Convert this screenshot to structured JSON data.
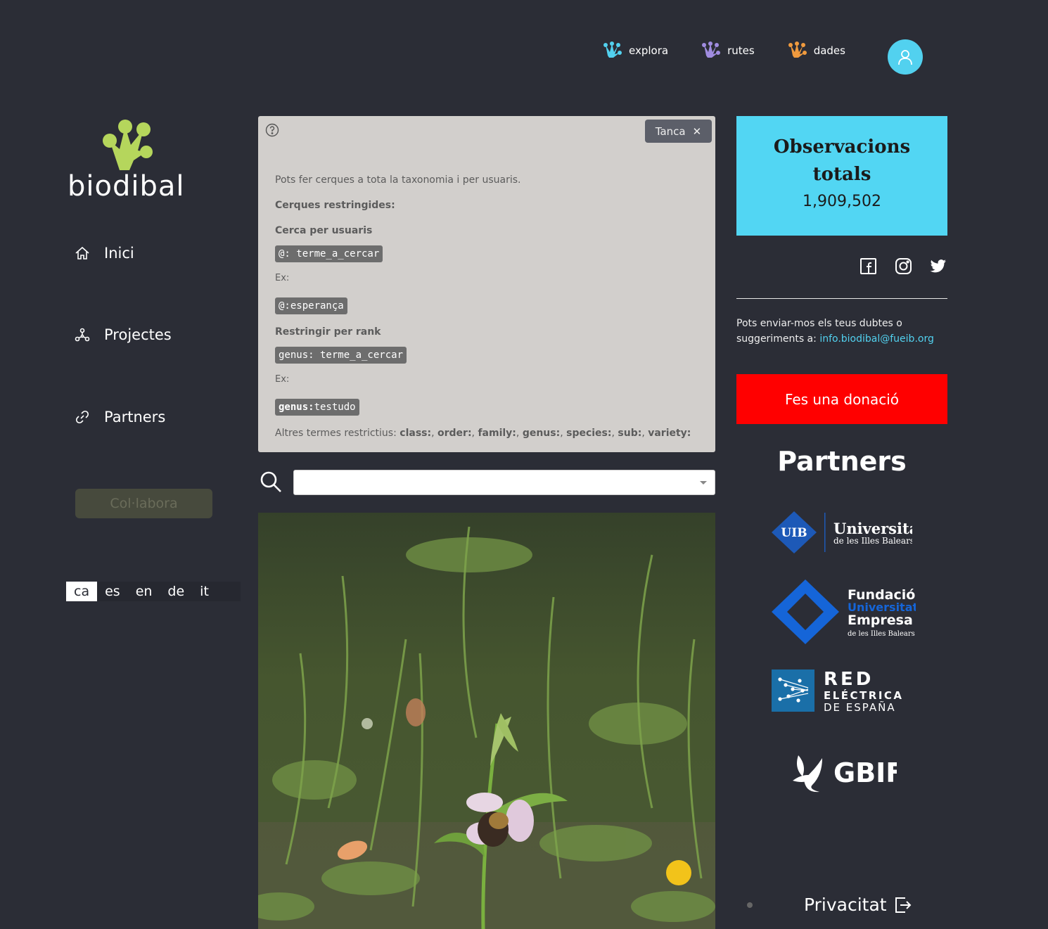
{
  "nav": {
    "items": [
      {
        "label": "explora",
        "color": "#52d1ef"
      },
      {
        "label": "rutes",
        "color": "#a08ce0"
      },
      {
        "label": "dades",
        "color": "#f09a3e"
      }
    ]
  },
  "brand": {
    "name": "biodibal",
    "accent": "#b5d65c"
  },
  "sidebar": {
    "items": [
      {
        "label": "Inici",
        "icon": "home-icon"
      },
      {
        "label": "Projectes",
        "icon": "network-icon"
      },
      {
        "label": "Partners",
        "icon": "link-icon"
      }
    ],
    "collabora": "Col·labora",
    "languages": [
      "ca",
      "es",
      "en",
      "de",
      "it"
    ],
    "active_language": "ca"
  },
  "help": {
    "close_label": "Tanca",
    "intro": "Pots fer cerques a tota la taxonomia i per usuaris.",
    "restricted_heading": "Cerques restringides:",
    "users_heading": "Cerca per usuaris",
    "users_code": "@: terme_a_cercar",
    "ex_label": "Ex:",
    "users_example": "@:esperança",
    "rank_heading": "Restringir per rank",
    "rank_code": "genus: terme_a_cercar",
    "rank_example_key": "genus:",
    "rank_example_value": "testudo",
    "other_label": "Altres termes restrictius:",
    "other_terms": [
      {
        "term": "class:",
        "sep": ", "
      },
      {
        "term": "order:",
        "sep": ", "
      },
      {
        "term": "family:",
        "sep": ", "
      },
      {
        "term": "genus:",
        "sep": ", "
      },
      {
        "term": "species:",
        "sep": ", "
      },
      {
        "term": "sub:",
        "sep": ", "
      },
      {
        "term": "variety:",
        "sep": ""
      }
    ]
  },
  "search": {
    "value": "",
    "placeholder": ""
  },
  "stats": {
    "title_line1": "Observacions",
    "title_line2": "totals",
    "value": "1,909,502"
  },
  "contact": {
    "text": "Pots enviar-mos els teus dubtes o suggeriments a:",
    "email": "info.biodibal@fueib.org"
  },
  "donate_label": "Fes una donació",
  "partners": {
    "title": "Partners",
    "uib": {
      "badge": "UIB",
      "name": "Universitat",
      "sub": "de les Illes Balears"
    },
    "fueib": {
      "line1": "Fundació",
      "line2": "Universitat",
      "line3": "Empresa",
      "sub": "de les Illes Balears"
    },
    "ree": {
      "line1": "RED",
      "line2": "ELÉCTRICA",
      "line3": "DE ESPAÑA"
    },
    "gbif": {
      "name": "GBIF"
    }
  },
  "footer": {
    "privacy_label": "Privacitat"
  }
}
